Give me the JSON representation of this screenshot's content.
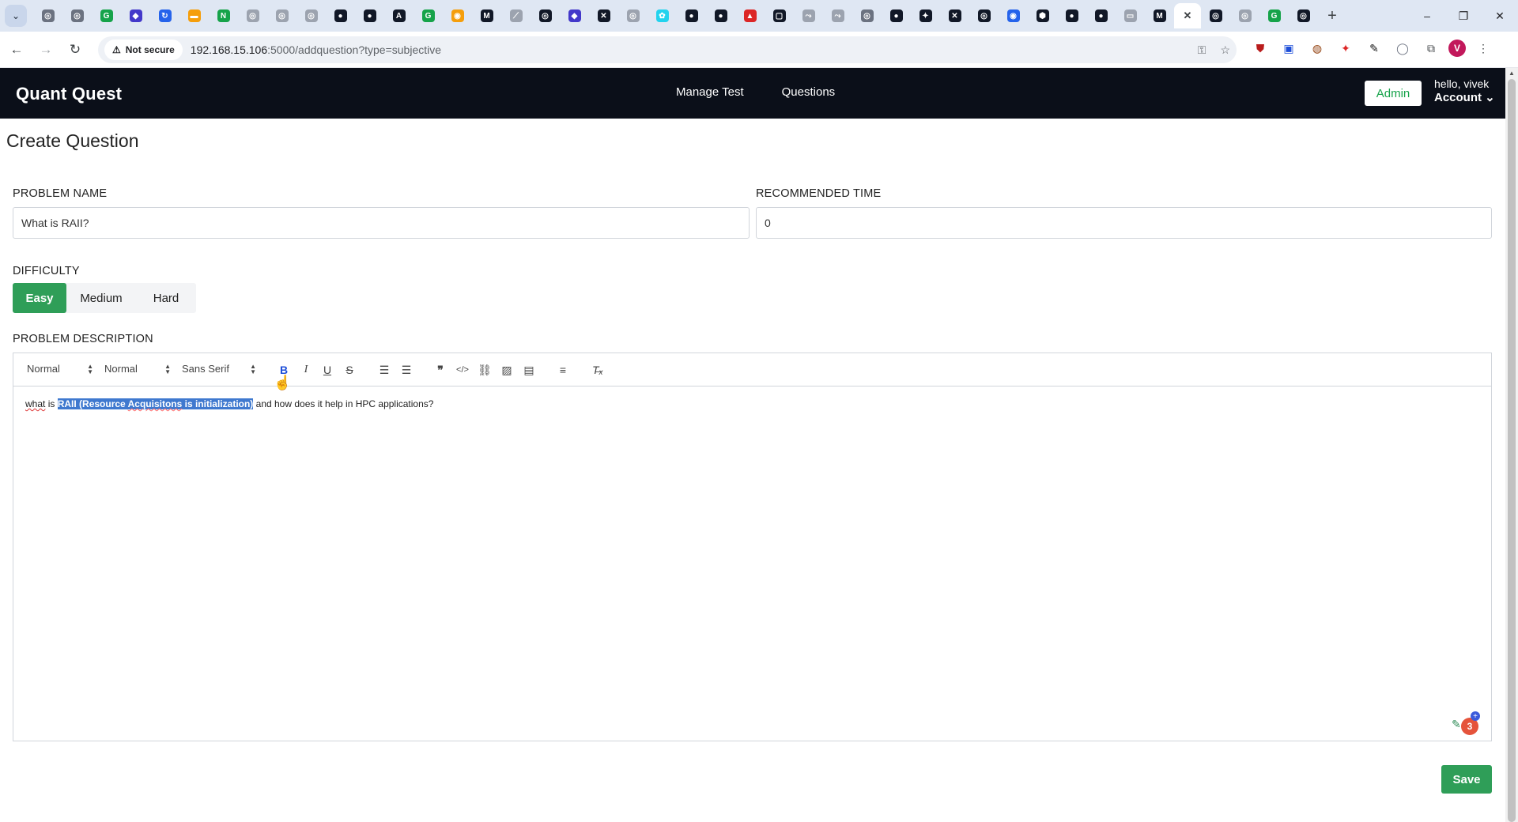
{
  "browser": {
    "tab_menu_icon": "chevron-down-icon",
    "favicons": [
      {
        "color": "#6b7280",
        "glyph": "◎"
      },
      {
        "color": "#6b7280",
        "glyph": "◎"
      },
      {
        "color": "#16a34a",
        "glyph": "G"
      },
      {
        "color": "#4338ca",
        "glyph": "◆"
      },
      {
        "color": "#2563eb",
        "glyph": "↻"
      },
      {
        "color": "#f59e0b",
        "glyph": "▬"
      },
      {
        "color": "#16a34a",
        "glyph": "N"
      },
      {
        "color": "#9ca3af",
        "glyph": "◎"
      },
      {
        "color": "#9ca3af",
        "glyph": "◎"
      },
      {
        "color": "#9ca3af",
        "glyph": "◎"
      },
      {
        "color": "#111827",
        "glyph": "●"
      },
      {
        "color": "#111827",
        "glyph": "●"
      },
      {
        "color": "#111827",
        "glyph": "A"
      },
      {
        "color": "#16a34a",
        "glyph": "G"
      },
      {
        "color": "#f59e0b",
        "glyph": "◉"
      },
      {
        "color": "#111827",
        "glyph": "M"
      },
      {
        "color": "#9ca3af",
        "glyph": "⟋"
      },
      {
        "color": "#111827",
        "glyph": "◎"
      },
      {
        "color": "#4338ca",
        "glyph": "◆"
      },
      {
        "color": "#111827",
        "glyph": "✕"
      },
      {
        "color": "#9ca3af",
        "glyph": "◎"
      },
      {
        "color": "#22d3ee",
        "glyph": "✿"
      },
      {
        "color": "#111827",
        "glyph": "●"
      },
      {
        "color": "#111827",
        "glyph": "●"
      },
      {
        "color": "#dc2626",
        "glyph": "▲"
      },
      {
        "color": "#111827",
        "glyph": "▢"
      },
      {
        "color": "#9ca3af",
        "glyph": "⤳"
      },
      {
        "color": "#9ca3af",
        "glyph": "⤳"
      },
      {
        "color": "#6b7280",
        "glyph": "◎"
      },
      {
        "color": "#111827",
        "glyph": "●"
      },
      {
        "color": "#111827",
        "glyph": "✦"
      },
      {
        "color": "#111827",
        "glyph": "✕"
      },
      {
        "color": "#111827",
        "glyph": "◎"
      },
      {
        "color": "#2563eb",
        "glyph": "◉"
      },
      {
        "color": "#111827",
        "glyph": "⬢"
      },
      {
        "color": "#111827",
        "glyph": "●"
      },
      {
        "color": "#111827",
        "glyph": "●"
      },
      {
        "color": "#9ca3af",
        "glyph": "▭"
      },
      {
        "color": "#111827",
        "glyph": "M"
      }
    ],
    "active_tab_icon": "close-icon",
    "favicons_after": [
      {
        "color": "#111827",
        "glyph": "◎"
      },
      {
        "color": "#9ca3af",
        "glyph": "◎"
      },
      {
        "color": "#16a34a",
        "glyph": "G"
      },
      {
        "color": "#111827",
        "glyph": "◎"
      }
    ],
    "new_tab_label": "+",
    "window_controls": [
      "–",
      "❐",
      "✕"
    ],
    "security_label": "Not secure",
    "url_host": "192.168.15.106",
    "url_path": ":5000/addquestion?type=subjective",
    "profile_initial": "V"
  },
  "nav": {
    "brand": "Quant Quest",
    "links": [
      "Manage Test",
      "Questions"
    ],
    "admin_label": "Admin",
    "greeting": "hello, vivek",
    "account_label": "Account ⌄"
  },
  "form": {
    "page_title": "Create Question",
    "problem_name_label": "PROBLEM NAME",
    "problem_name_value": "What is RAII?",
    "recommended_time_label": "RECOMMENDED TIME",
    "recommended_time_value": "0",
    "difficulty_label": "DIFFICULTY",
    "difficulty_options": [
      "Easy",
      "Medium",
      "Hard"
    ],
    "difficulty_selected": "Easy",
    "description_label": "PROBLEM DESCRIPTION",
    "editor": {
      "header_select": "Normal",
      "size_select": "Normal",
      "font_select": "Sans Serif",
      "content_pre_a": "what",
      "content_pre_b": " is ",
      "content_sel_a": "RAII (Resource ",
      "content_sel_b": "Acquisitons",
      "content_sel_c": " is initialization)",
      "content_post": " and how does it help in HPC applications?"
    },
    "grammar_count": "3",
    "save_label": "Save"
  },
  "colors": {
    "navbar": "#0b0f19",
    "accent_green": "#2f9e58",
    "selection": "#3f79cf"
  }
}
